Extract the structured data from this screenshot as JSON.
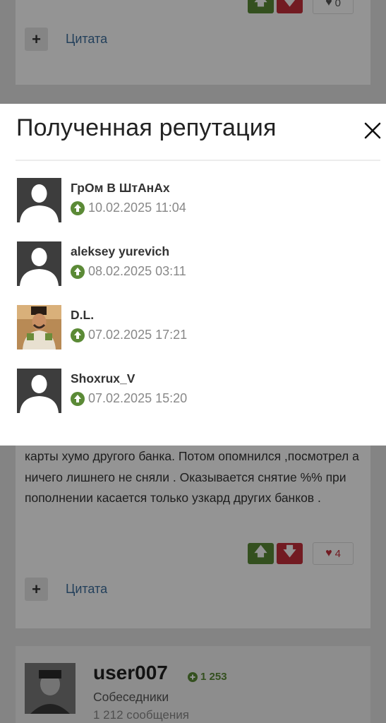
{
  "background": {
    "top_post": {
      "like_count": "0",
      "quote_label": "Цитата"
    },
    "mid_post": {
      "text": "карты хумо  другого банка. Потом опомнился ,посмотрел а ничего лишнего не сняли . Оказывается снятие  %%  при пополнении касается только узкард других банков .",
      "like_count": "4",
      "quote_label": "Цитата"
    },
    "author": {
      "name": "user007",
      "reputation": "1 253",
      "group": "Собеседники",
      "posts": "1 212 сообщения"
    }
  },
  "modal": {
    "title": "Полученная репутация",
    "items": [
      {
        "name": "ГрОм В ШтАнАх",
        "date": "10.02.2025 11:04",
        "avatar": "default-avatar"
      },
      {
        "name": "aleksey yurevich",
        "date": "08.02.2025 03:11",
        "avatar": "default-avatar"
      },
      {
        "name": "D.L.",
        "date": "07.02.2025 17:21",
        "avatar": "photo-avatar"
      },
      {
        "name": "Shoxrux_V",
        "date": "07.02.2025 15:20",
        "avatar": "default-avatar"
      }
    ]
  },
  "colors": {
    "upvote": "#5b8a36",
    "downvote": "#c4303c",
    "link": "#3d6e9e"
  }
}
